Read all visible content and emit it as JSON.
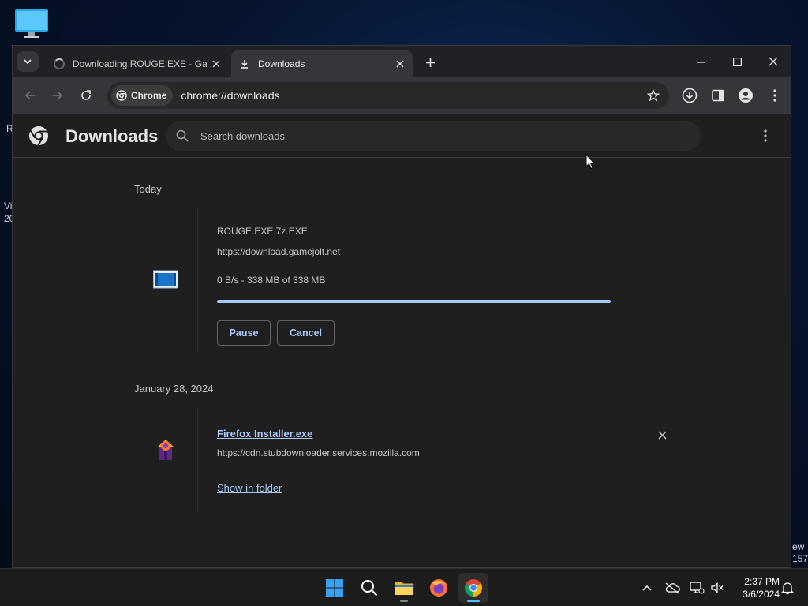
{
  "desktop": {
    "fragments": [
      "R",
      "Vi",
      "20",
      "ew",
      "157"
    ]
  },
  "browser": {
    "tabs": [
      {
        "title": "Downloading ROUGE.EXE - GameJolt",
        "active": false
      },
      {
        "title": "Downloads",
        "active": true
      }
    ],
    "address": {
      "chip_label": "Chrome",
      "url": "chrome://downloads"
    }
  },
  "downloads_page": {
    "title": "Downloads",
    "search_placeholder": "Search downloads",
    "groups": [
      {
        "date": "Today",
        "items": [
          {
            "filename": "ROUGE.EXE.7z.EXE",
            "url": "https://download.gamejolt.net",
            "status": "0 B/s - 338 MB of 338 MB",
            "progress": 1.0,
            "actions": [
              "Pause",
              "Cancel"
            ]
          }
        ]
      },
      {
        "date": "January 28, 2024",
        "items": [
          {
            "filename": "Firefox Installer.exe",
            "url": "https://cdn.stubdownloader.services.mozilla.com",
            "link_action": "Show in folder"
          }
        ]
      }
    ]
  },
  "taskbar": {
    "apps": [
      "start",
      "search",
      "file-explorer",
      "firefox",
      "chrome"
    ],
    "clock": {
      "time": "2:37 PM",
      "date": "3/6/2024"
    }
  },
  "colors": {
    "accent": "#a8c7fa",
    "page_bg": "#1f1f1f",
    "toolbar_bg": "#35363a",
    "taskbar_active": "#4cc2ff"
  }
}
